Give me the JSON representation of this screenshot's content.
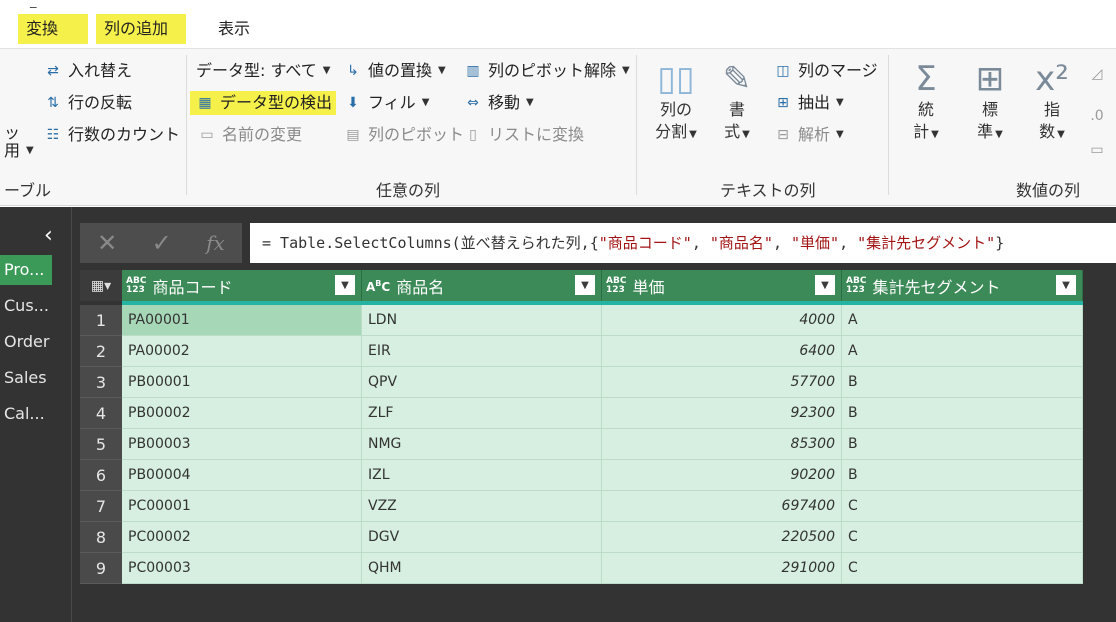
{
  "tabs": {
    "title_sliver": "_",
    "items": [
      {
        "label": "変換"
      },
      {
        "label": "列の追加"
      },
      {
        "label": "表示"
      }
    ]
  },
  "ribbon": {
    "table_group": {
      "partial_label_a": "ッ",
      "partial_label_b": "用",
      "transpose": "入れ替え",
      "reverse_rows": "行の反転",
      "count_rows": "行数のカウント",
      "group_label": "ーブル"
    },
    "any_column_group": {
      "data_type": "データ型: すべて",
      "detect_type": "データ型の検出",
      "rename": "名前の変更",
      "replace_values": "値の置換",
      "fill": "フィル",
      "pivot_column": "列のピボット",
      "unpivot_columns": "列のピボット解除",
      "move": "移動",
      "convert_to_list": "リストに変換",
      "group_label": "任意の列"
    },
    "text_column_group": {
      "split_column_a": "列の",
      "split_column_b": "分割",
      "format_a": "書",
      "format_b": "式",
      "merge_columns": "列のマージ",
      "extract": "抽出",
      "parse": "解析",
      "group_label": "テキストの列"
    },
    "number_column_group": {
      "statistics_a": "統",
      "statistics_b": "計",
      "standard_a": "標",
      "standard_b": "準",
      "scientific_a": "指",
      "scientific_b": "数",
      "group_label": "数値の列"
    }
  },
  "queries": [
    {
      "label": "Pro..."
    },
    {
      "label": "Cus..."
    },
    {
      "label": "Order"
    },
    {
      "label": "Sales"
    },
    {
      "label": "Cal..."
    }
  ],
  "formula": {
    "prefix": "= Table.SelectColumns(並べ替えられた列,{",
    "s1": "\"商品コード\"",
    "sep1": ", ",
    "s2": "\"商品名\"",
    "sep2": ", ",
    "s3": "\"単価\"",
    "sep3": ", ",
    "s4": "\"集計先セグメント\"",
    "suffix": "}"
  },
  "grid": {
    "columns": [
      {
        "name": "商品コード",
        "type_top": "ABC",
        "type_bottom": "123"
      },
      {
        "name": "商品名",
        "type_top": "A",
        "type_bottom": "C"
      },
      {
        "name": "単価",
        "type_top": "ABC",
        "type_bottom": "123"
      },
      {
        "name": "集計先セグメント",
        "type_top": "ABC",
        "type_bottom": "123"
      }
    ],
    "rows": [
      {
        "idx": "1",
        "code": "PA00001",
        "name": "LDN",
        "price": "4000",
        "seg": "A"
      },
      {
        "idx": "2",
        "code": "PA00002",
        "name": "EIR",
        "price": "6400",
        "seg": "A"
      },
      {
        "idx": "3",
        "code": "PB00001",
        "name": "QPV",
        "price": "57700",
        "seg": "B"
      },
      {
        "idx": "4",
        "code": "PB00002",
        "name": "ZLF",
        "price": "92300",
        "seg": "B"
      },
      {
        "idx": "5",
        "code": "PB00003",
        "name": "NMG",
        "price": "85300",
        "seg": "B"
      },
      {
        "idx": "6",
        "code": "PB00004",
        "name": "IZL",
        "price": "90200",
        "seg": "B"
      },
      {
        "idx": "7",
        "code": "PC00001",
        "name": "VZZ",
        "price": "697400",
        "seg": "C"
      },
      {
        "idx": "8",
        "code": "PC00002",
        "name": "DGV",
        "price": "220500",
        "seg": "C"
      },
      {
        "idx": "9",
        "code": "PC00003",
        "name": "QHM",
        "price": "291000",
        "seg": "C"
      }
    ]
  },
  "colors": {
    "highlight": "#f6f14a",
    "header_green": "#3b8a57",
    "cell_green": "#d6efe0",
    "dark_bg": "#333333"
  }
}
